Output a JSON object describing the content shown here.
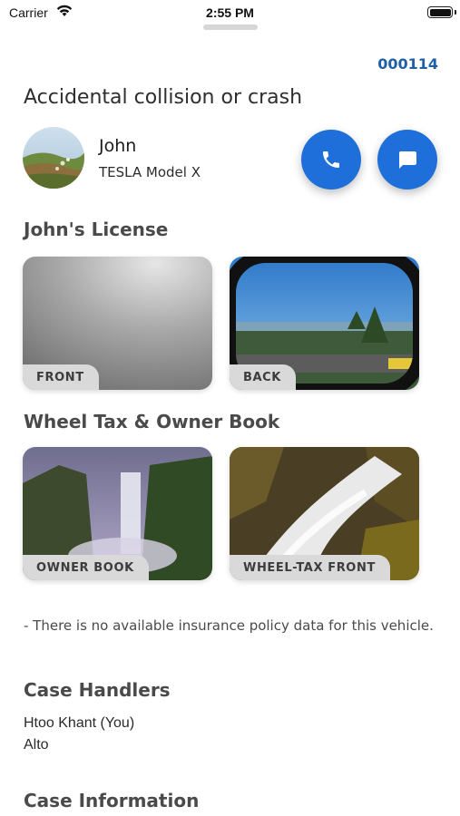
{
  "status_bar": {
    "carrier": "Carrier",
    "time": "2:55 PM"
  },
  "case": {
    "number": "000114",
    "title": "Accidental collision or crash"
  },
  "driver": {
    "name": "John",
    "car": "TESLA Model X"
  },
  "actions": {
    "call_icon": "phone-icon",
    "message_icon": "chat-bubble-icon"
  },
  "license": {
    "title": "John's License",
    "cards": [
      {
        "label": "FRONT"
      },
      {
        "label": "BACK"
      }
    ]
  },
  "documents": {
    "title": "Wheel Tax & Owner Book",
    "cards": [
      {
        "label": "OWNER BOOK"
      },
      {
        "label": "WHEEL-TAX FRONT"
      }
    ]
  },
  "insurance_note": "- There is no available insurance policy data for this vehicle.",
  "case_handlers": {
    "title": "Case Handlers",
    "names": [
      "Htoo Khant (You)",
      "Alto"
    ]
  },
  "case_information": {
    "title": "Case Information"
  },
  "colors": {
    "accent": "#1e6fd9",
    "case_number": "#1f5fa8",
    "tag_bg": "#d9d9d9"
  }
}
